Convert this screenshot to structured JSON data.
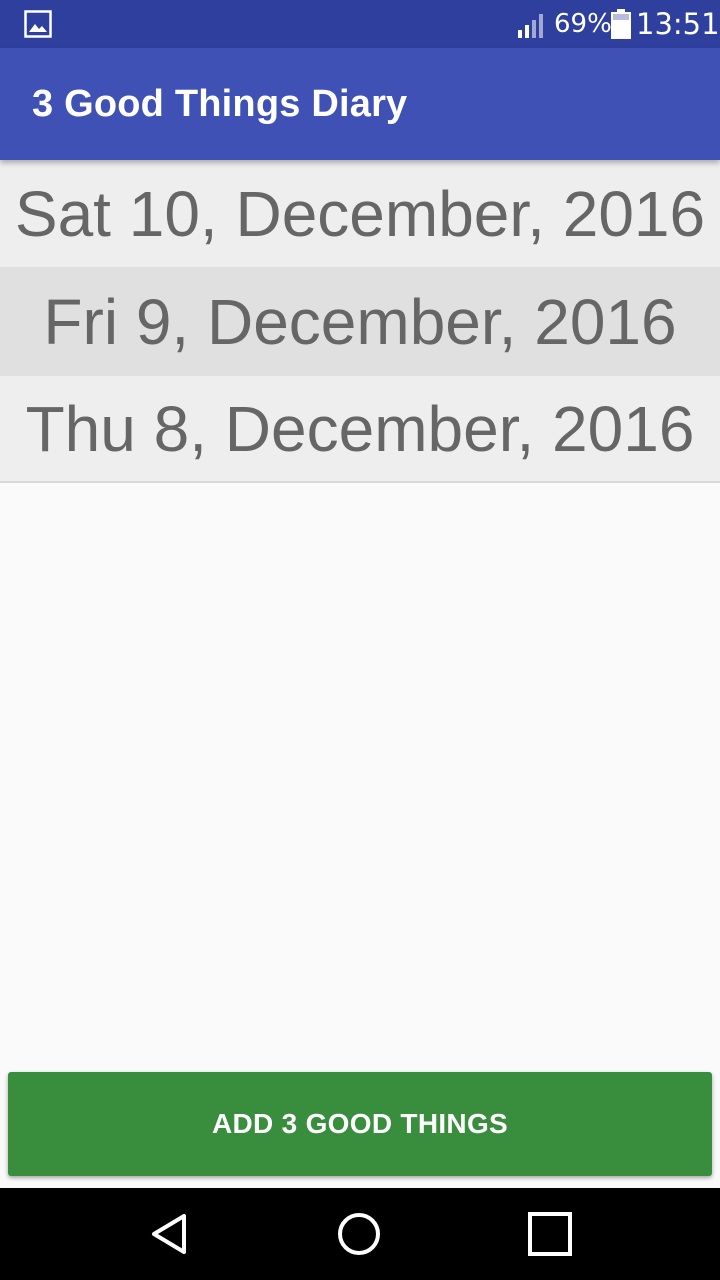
{
  "status_bar": {
    "battery_percent": "69%",
    "time": "13:51",
    "icons": [
      "gallery-icon",
      "signal-icon",
      "battery-icon"
    ]
  },
  "app_bar": {
    "title": "3 Good Things Diary"
  },
  "entries": [
    {
      "date": "Sat 10, December, 2016"
    },
    {
      "date": "Fri 9, December, 2016"
    },
    {
      "date": "Thu 8, December, 2016"
    }
  ],
  "add_button": {
    "label": "ADD 3 GOOD THINGS"
  },
  "nav_bar": {
    "icons": [
      "back-icon",
      "home-icon",
      "recents-icon"
    ]
  },
  "colors": {
    "status_bar": "#2f3f9e",
    "app_bar": "#3f51b5",
    "add_button": "#388e3c",
    "row_text": "#666666"
  }
}
